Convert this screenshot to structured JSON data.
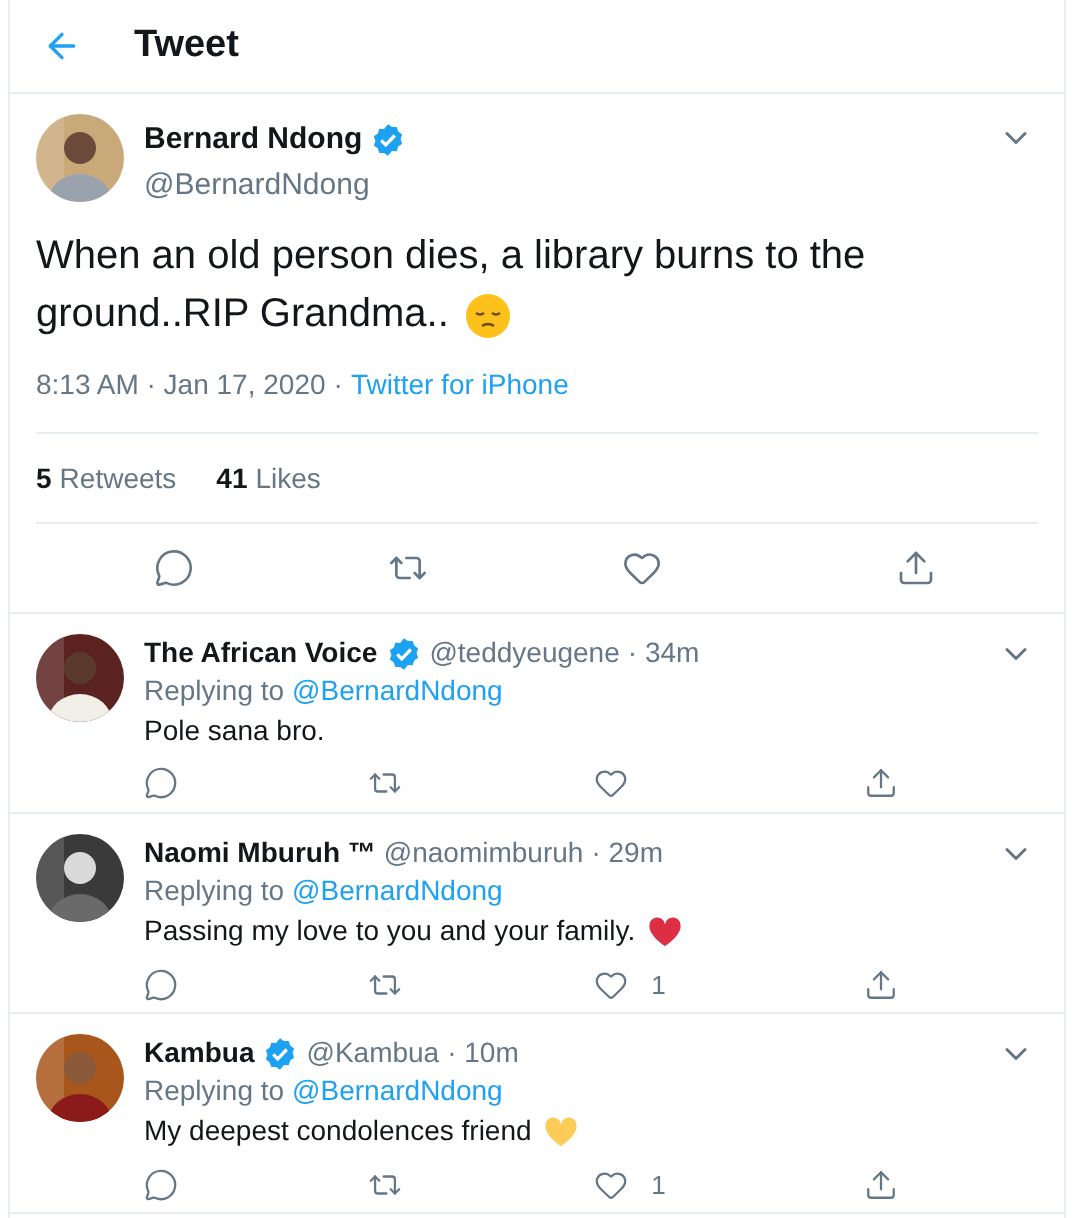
{
  "header": {
    "title": "Tweet"
  },
  "tweet": {
    "name": "Bernard Ndong",
    "verified": true,
    "handle": "@BernardNdong",
    "text": "When an old person dies, a library burns to the ground..RIP Grandma..",
    "time": "8:13 AM · Jan 17, 2020",
    "separator": "·",
    "source": "Twitter for iPhone",
    "stats": [
      {
        "count": "5",
        "label": "Retweets"
      },
      {
        "count": "41",
        "label": "Likes"
      }
    ]
  },
  "replies": [
    {
      "name": "The African Voice",
      "verified": true,
      "handle": "@teddyeugene",
      "time": "· 34m",
      "replying_label": "Replying to",
      "replying_to": "@BernardNdong",
      "text": "Pole sana bro."
    },
    {
      "name": "Naomi Mburuh ™",
      "verified": false,
      "handle": "@naomimburuh",
      "time": "· 29m",
      "replying_label": "Replying to",
      "replying_to": "@BernardNdong",
      "text": "Passing my love to you and your family.",
      "color": "#dd2e44",
      "like_count": "1"
    },
    {
      "name": "Kambua",
      "verified": true,
      "handle": "@Kambua",
      "time": "· 10m",
      "replying_label": "Replying to",
      "replying_to": "@BernardNdong",
      "text": "My deepest condolences friend",
      "color": "#fdcb58",
      "like_count": "1"
    }
  ]
}
